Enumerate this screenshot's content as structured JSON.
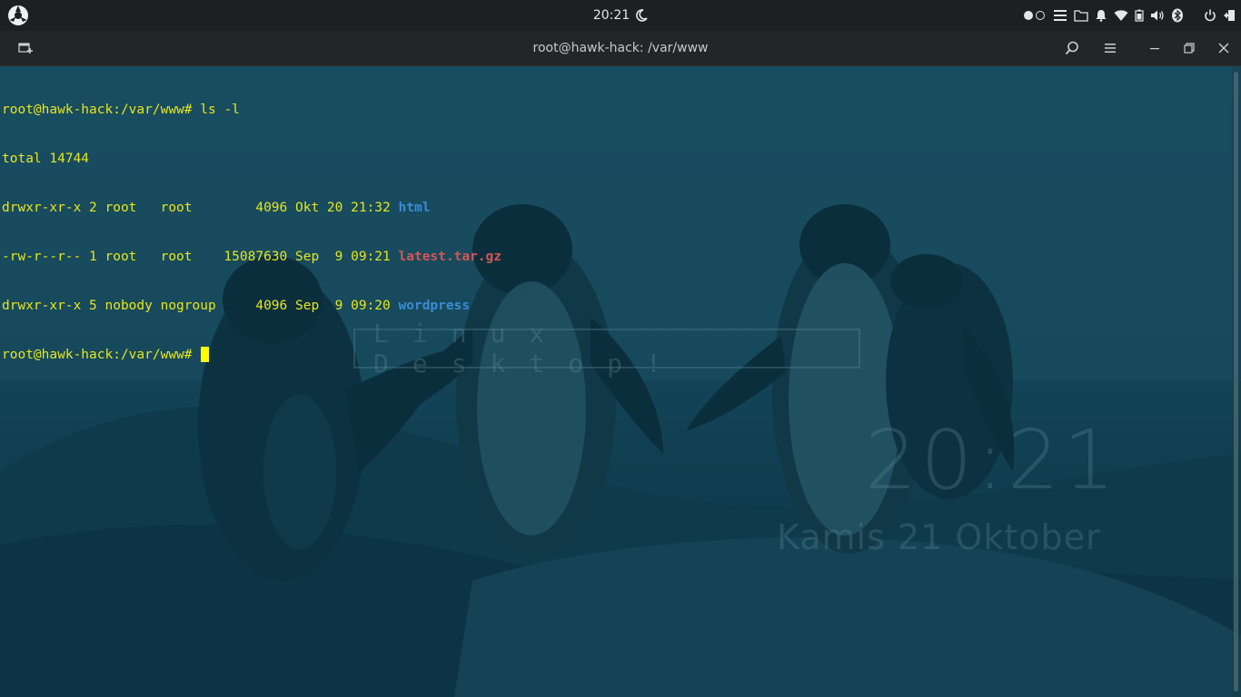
{
  "top_panel": {
    "clock": "20:21",
    "moon_icon": "crescent-moon-icon",
    "tray_icons": [
      "toggle-icon",
      "menu-icon",
      "folder-icon",
      "bell-icon",
      "wifi-icon",
      "battery-icon",
      "volume-icon",
      "bluetooth-icon",
      "power-icon",
      "logout-icon"
    ]
  },
  "terminal": {
    "title": "root@hawk-hack: /var/www",
    "lines": [
      {
        "prompt": "root@hawk-hack:/var/www# ",
        "command": "ls -l"
      },
      {
        "text": "total 14744"
      },
      {
        "meta": "drwxr-xr-x 2 root   root        4096 Okt 20 21:32 ",
        "name": "html",
        "kind": "dir"
      },
      {
        "meta": "-rw-r--r-- 1 root   root    15087630 Sep  9 09:21 ",
        "name": "latest.tar.gz",
        "kind": "archive"
      },
      {
        "meta": "drwxr-xr-x 5 nobody nogroup     4096 Sep  9 09:20 ",
        "name": "wordpress",
        "kind": "dir"
      },
      {
        "prompt": "root@hawk-hack:/var/www# ",
        "command": ""
      }
    ]
  },
  "wallpaper": {
    "banner": "Linux Desktop!",
    "clock": "20:21",
    "date": "Kamis 21 Oktober"
  },
  "colors": {
    "prompt": "#e6e61e",
    "dir": "#3b8bd6",
    "archive": "#d65454",
    "panel": "#1d1f21"
  }
}
